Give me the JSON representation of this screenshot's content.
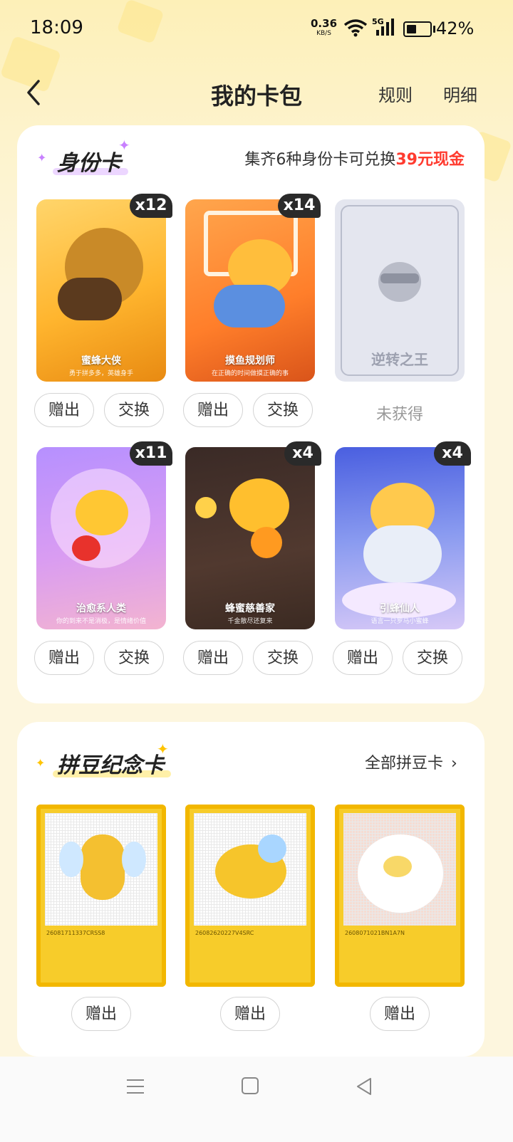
{
  "status": {
    "time": "18:09",
    "net_speed": "0.36",
    "net_unit": "KB/S",
    "signal": "5G",
    "battery": "42%",
    "battery_level": 0.42
  },
  "header": {
    "title": "我的卡包",
    "rules": "规则",
    "details": "明细"
  },
  "identity": {
    "title": "身份卡",
    "promo_prefix": "集齐6种身份卡可兑换",
    "promo_highlight": "39元现金",
    "cards": [
      {
        "name": "蜜蜂大侠",
        "sub": "勇于拼多多，英雄身手",
        "count": "x12",
        "owned": true
      },
      {
        "name": "摸鱼规划师",
        "sub": "在正确的时间做摸正确的事",
        "count": "x14",
        "owned": true
      },
      {
        "name": "逆转之王",
        "sub": "",
        "count": "",
        "owned": false,
        "status": "未获得"
      },
      {
        "name": "治愈系人类",
        "sub": "你的到来不是消极，是情绪价值",
        "count": "x11",
        "owned": true
      },
      {
        "name": "蜂蜜慈善家",
        "sub": "千金散尽还复来",
        "count": "x4",
        "owned": true
      },
      {
        "name": "引蜂仙人",
        "sub": "语言一只罗马小蜜蜂",
        "count": "x4",
        "owned": true
      }
    ],
    "gift_label": "赠出",
    "trade_label": "交换"
  },
  "pindou": {
    "title": "拼豆纪念卡",
    "all_link": "全部拼豆卡",
    "cards": [
      {
        "code": "26081711337CRSS8"
      },
      {
        "code": "26082620227V4SRC"
      },
      {
        "code": "2608071021BN1A7N"
      }
    ],
    "gift_label": "赠出"
  },
  "colors": {
    "accent_red": "#ff3b2f",
    "card_gold": "#f7cc2a",
    "badge_bg": "#2a2a2a"
  }
}
